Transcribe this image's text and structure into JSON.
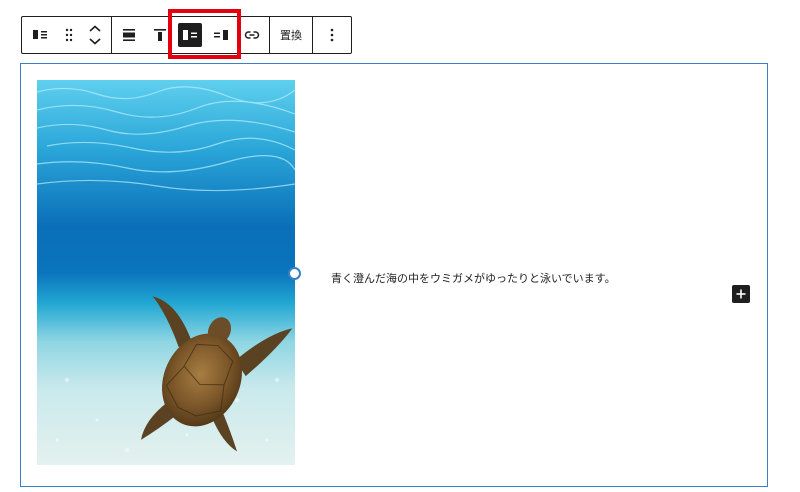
{
  "toolbar": {
    "block_type": {
      "icon": "media-text-icon"
    },
    "drag": {
      "icon": "drag-handle-icon"
    },
    "move": {
      "up_icon": "chevron-up-icon",
      "down_icon": "chevron-down-icon"
    },
    "align": {
      "icon": "align-wide-icon"
    },
    "vertical_align": {
      "icon": "align-top-icon"
    },
    "media_left": {
      "icon": "media-left-icon",
      "active": true
    },
    "media_right": {
      "icon": "media-right-icon"
    },
    "link": {
      "icon": "link-icon"
    },
    "replace_label": "置換",
    "more": {
      "icon": "more-vertical-icon"
    }
  },
  "block": {
    "image": {
      "subject": "sea-turtle-photo"
    },
    "text": "青く澄んだ海の中をウミガメがゆったりと泳いでいます。",
    "inserter_label": "+"
  },
  "colors": {
    "toolbar_border": "#1e1e1e",
    "active_bg": "#1e1e1e",
    "highlight": "#e3000f",
    "block_border": "#3582c4"
  }
}
